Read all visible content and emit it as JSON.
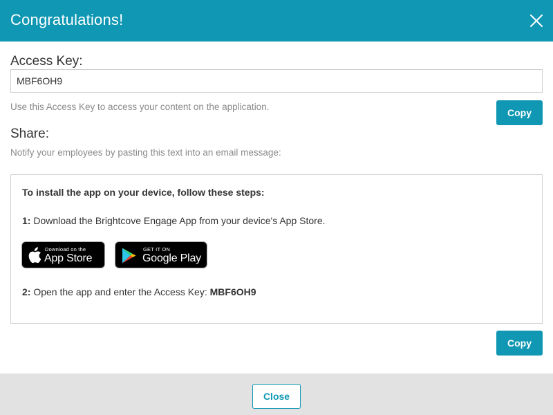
{
  "dialog": {
    "title": "Congratulations!",
    "close_icon": "close-icon"
  },
  "access_key": {
    "label": "Access Key:",
    "value": "MBF6OH9",
    "help": "Use this Access Key to access your content on the application.",
    "copy_label": "Copy"
  },
  "share": {
    "label": "Share:",
    "help": "Notify your employees by pasting this text into an email message:",
    "heading": "To install the app on your device, follow these steps:",
    "step1_num": "1:",
    "step1_text": " Download the Brightcove Engage App from your device's App Store.",
    "step2_num": "2:",
    "step2_text": " Open the app and enter the Access Key: ",
    "step2_key": "MBF6OH9",
    "copy_label": "Copy"
  },
  "badges": {
    "app_store": {
      "small": "Download on the",
      "big": "App Store",
      "icon": "apple-icon"
    },
    "google_play": {
      "small": "GET IT ON",
      "big": "Google Play",
      "icon": "google-play-icon"
    }
  },
  "footer": {
    "close_label": "Close"
  },
  "colors": {
    "accent": "#0f97b3",
    "footer_bg": "#e2e2e2",
    "help_text": "#8a8a8a"
  }
}
